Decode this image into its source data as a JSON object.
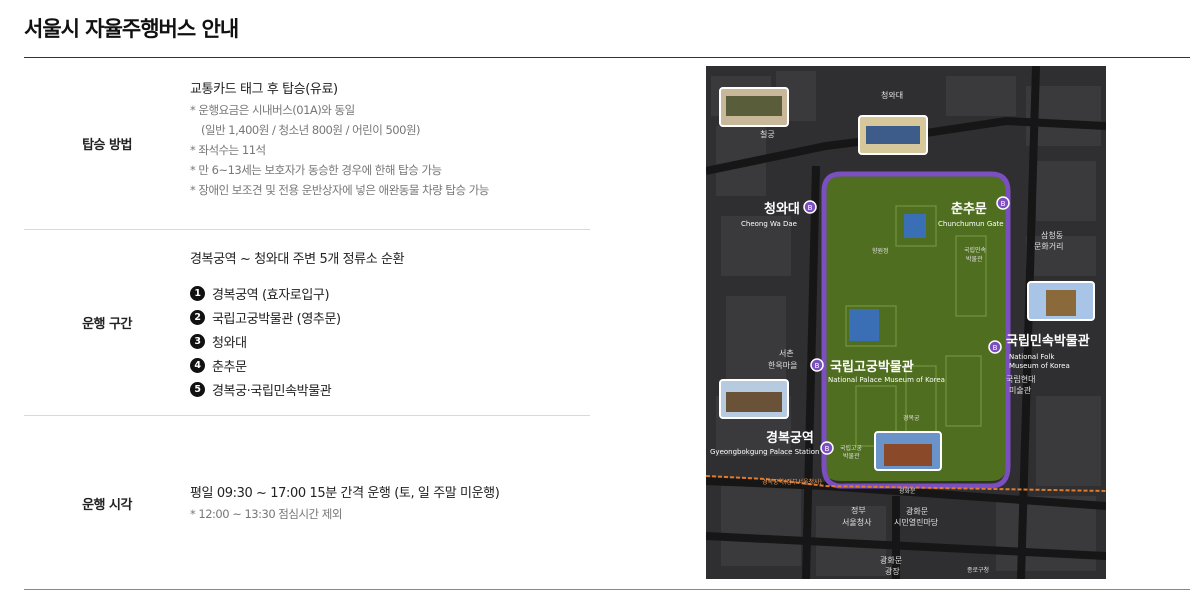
{
  "page": {
    "title": "서울시 자율주행버스 안내"
  },
  "boarding": {
    "header": "탑승 방법",
    "main": "교통카드 태그 후 탑승(유료)",
    "notes": [
      "* 운행요금은 시내버스(01A)와 동일",
      "(일반 1,400원 / 청소년 800원 / 어린이 500원)",
      "* 좌석수는 11석",
      "* 만 6~13세는 보호자가 동승한 경우에 한해 탑승 가능",
      "* 장애인 보조견 및 전용 운반상자에 넣은 애완동물 차량 탑승 가능"
    ]
  },
  "route": {
    "header": "운행 구간",
    "main": "경복궁역 ~ 청와대 주변 5개 정류소 순환",
    "stops": [
      {
        "num": "1",
        "name": "경복궁역 (효자로입구)"
      },
      {
        "num": "2",
        "name": "국립고궁박물관 (영추문)"
      },
      {
        "num": "3",
        "name": "청와대"
      },
      {
        "num": "4",
        "name": "춘추문"
      },
      {
        "num": "5",
        "name": "경복궁·국립민속박물관"
      }
    ]
  },
  "hours": {
    "header": "운행 시각",
    "main": "평일 09:30 ~ 17:00 15분 간격 운행 (토, 일 주말 미운행)",
    "notes": [
      "* 12:00 ~ 13:30 점심시간 제외"
    ]
  },
  "map": {
    "stations": {
      "cheongwadae": {
        "ko": "청와대",
        "en": "Cheong Wa Dae"
      },
      "chunchumun": {
        "ko": "춘추문",
        "en": "Chunchumun Gate"
      },
      "folk_museum": {
        "ko": "국립민속박물관",
        "en1": "National Folk",
        "en2": "Museum of Korea"
      },
      "palace_museum": {
        "ko": "국립고궁박물관",
        "en": "National Palace Museum of Korea"
      },
      "gyeongbokgung_station": {
        "ko": "경복궁역",
        "en": "Gyeongbokgung Palace Station"
      }
    },
    "badge": "B",
    "places": {
      "chilgung": "칠궁",
      "cheongwadae_top": "청와대",
      "samcheong1": "삼청동",
      "samcheong2": "문화거리",
      "seochon1": "서촌",
      "seochon2": "한옥마을",
      "mmca1": "국립현대",
      "mmca2": "미술관",
      "gov1": "정부",
      "gov2": "서울청사",
      "gwanghwamun": "광화문",
      "gwanghwamun_sq1": "광화문",
      "gwanghwamun_sq2": "시민열린마당",
      "plaza1": "광화문",
      "plaza2": "광장",
      "jonggak": "종로구청",
      "folk_small1": "국립민속",
      "folk_small2": "박물관",
      "palace_small1": "국립고궁",
      "palace_small2": "박물관",
      "hyangwonjeong": "향원정",
      "jeongbokgung": "경복궁",
      "exit_label": "경복궁역(정부서울청사)"
    },
    "colors": {
      "route": "#7b4fc0",
      "green": "#4f6e1f",
      "road": "#1b1b1b",
      "bg": "#2b2b2d"
    }
  }
}
